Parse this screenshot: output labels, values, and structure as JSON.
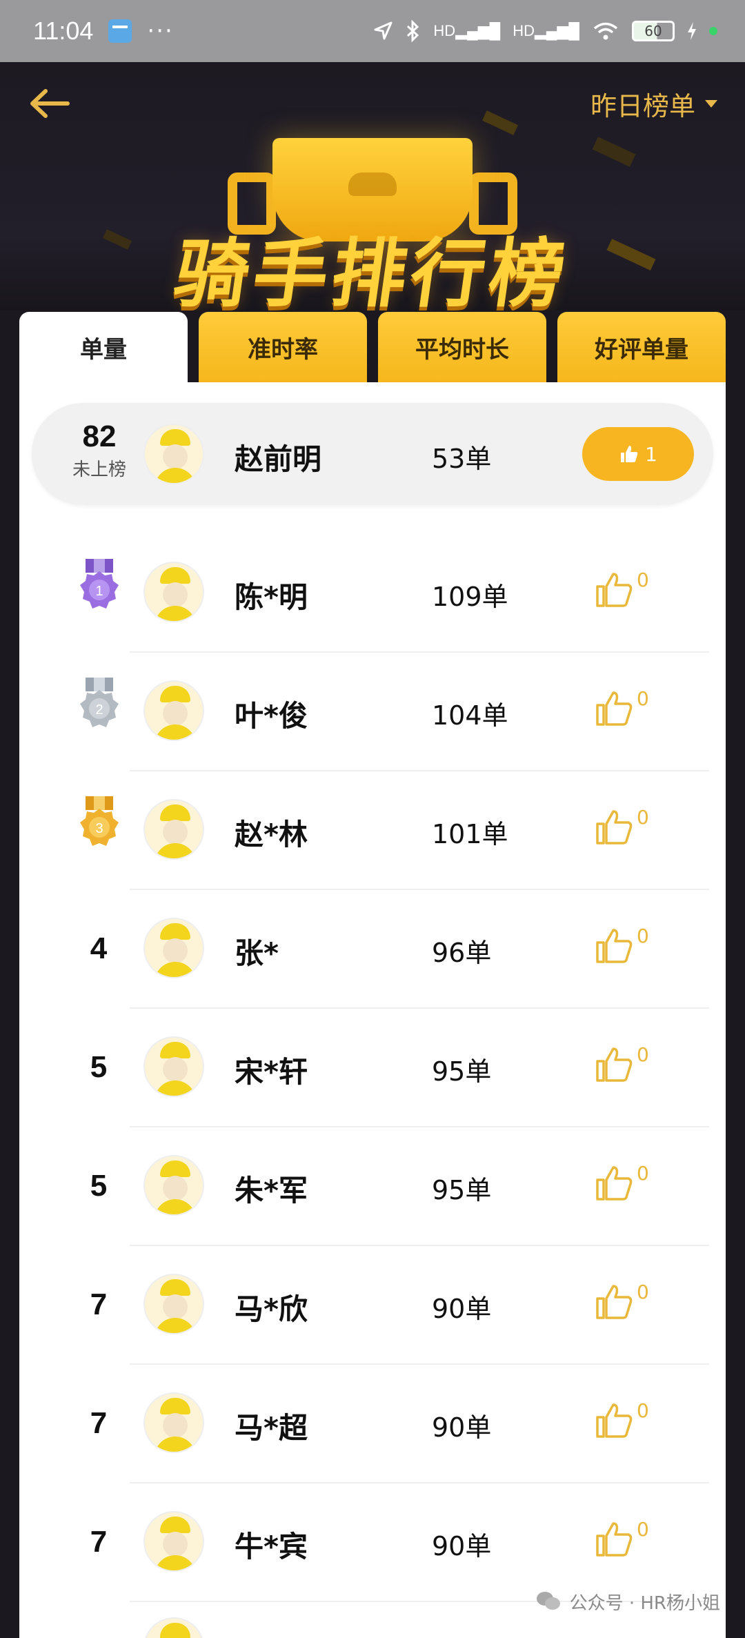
{
  "status_bar": {
    "time": "11:04",
    "dots": "···",
    "signal_1": "HD",
    "signal_2": "HD",
    "battery": "60"
  },
  "header": {
    "back_label": "←",
    "range_label": "昨日榜单",
    "banner_title": "骑手排行榜"
  },
  "tabs": [
    {
      "label": "单量",
      "active": true
    },
    {
      "label": "准时率",
      "active": false
    },
    {
      "label": "平均时长",
      "active": false
    },
    {
      "label": "好评单量",
      "active": false
    }
  ],
  "my_rank": {
    "rank": "82",
    "rank_note": "未上榜",
    "name": "赵前明",
    "orders": "53单",
    "likes": "1"
  },
  "leaderboard": [
    {
      "rank": "1",
      "medal": "purple",
      "name": "陈*明",
      "orders": "109单",
      "likes": "0"
    },
    {
      "rank": "2",
      "medal": "silver",
      "name": "叶*俊",
      "orders": "104单",
      "likes": "0"
    },
    {
      "rank": "3",
      "medal": "gold",
      "name": "赵*林",
      "orders": "101单",
      "likes": "0"
    },
    {
      "rank": "4",
      "medal": "",
      "name": "张*",
      "orders": "96单",
      "likes": "0"
    },
    {
      "rank": "5",
      "medal": "",
      "name": "宋*轩",
      "orders": "95单",
      "likes": "0"
    },
    {
      "rank": "5",
      "medal": "",
      "name": "朱*军",
      "orders": "95单",
      "likes": "0"
    },
    {
      "rank": "7",
      "medal": "",
      "name": "马*欣",
      "orders": "90单",
      "likes": "0"
    },
    {
      "rank": "7",
      "medal": "",
      "name": "马*超",
      "orders": "90单",
      "likes": "0"
    },
    {
      "rank": "7",
      "medal": "",
      "name": "牛*宾",
      "orders": "90单",
      "likes": "0"
    }
  ],
  "watermark": {
    "text": "公众号 · HR杨小姐"
  },
  "colors": {
    "accent": "#f6b521",
    "header_bg": "#1d1a22",
    "like_outline": "#e9b83a"
  }
}
